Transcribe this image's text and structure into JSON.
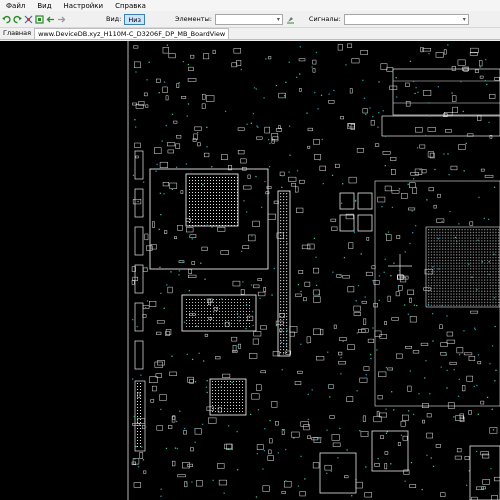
{
  "menu": [
    "Файл",
    "Вид",
    "Настройки",
    "Справка"
  ],
  "toolbar": {
    "view_label": "Вид:",
    "view_bottom": "Низ",
    "elements_label": "Элементы:",
    "elements_value": "",
    "signals_label": "Сигналы:",
    "signals_value": ""
  },
  "tabs": {
    "home": "Главная",
    "file": "www.DeviceDB.xyz_H110M-C_D3206F_DP_MB_BoardView"
  },
  "colors": {
    "board_background": "#000000",
    "outline": "#e8e8e8",
    "pad_cyan": "#1f9aa0",
    "pad_green": "#3ec57a"
  }
}
